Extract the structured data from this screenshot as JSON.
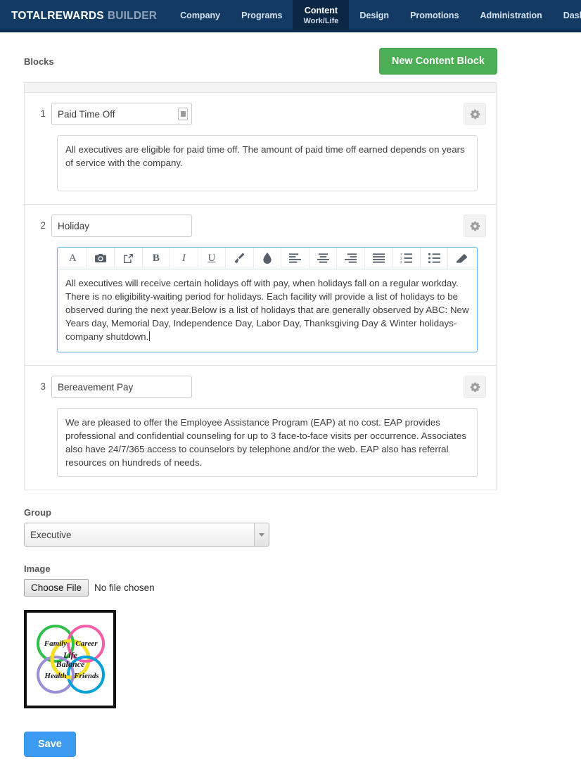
{
  "brand": {
    "strong": "TOTALREWARDS",
    "light": "BUILDER"
  },
  "nav": {
    "items": [
      {
        "label": "Company",
        "sub": "",
        "active": false,
        "name": "nav-item-company"
      },
      {
        "label": "Programs",
        "sub": "",
        "active": false,
        "name": "nav-item-programs"
      },
      {
        "label": "Content",
        "sub": "Work/Life",
        "active": true,
        "name": "nav-item-content"
      },
      {
        "label": "Design",
        "sub": "",
        "active": false,
        "name": "nav-item-design"
      },
      {
        "label": "Promotions",
        "sub": "",
        "active": false,
        "name": "nav-item-promotions"
      },
      {
        "label": "Administration",
        "sub": "",
        "active": false,
        "name": "nav-item-administration"
      },
      {
        "label": "Dashboard",
        "sub": "",
        "active": false,
        "name": "nav-item-dashboard"
      }
    ]
  },
  "toolbar": {
    "blocks_label": "Blocks",
    "new_block_label": "New Content Block",
    "new_block_color": "#4cae55"
  },
  "blocks": [
    {
      "number": "1",
      "title": "Paid Time Off",
      "body": "All executives are eligible for paid time off. The amount of paid time off earned depends on years of service with the company.",
      "has_grip": true,
      "editing": false
    },
    {
      "number": "2",
      "title": "Holiday",
      "body": "All executives will receive certain holidays off with pay, when holidays fall on a regular workday. There is no eligibility-waiting period for holidays. Each facility will provide a list of holidays to be observed during the next year.Below is a list of holidays that are generally observed by ABC: New Years day, Memorial Day, Independence Day, Labor Day, Thanksgiving Day & Winter holidays-company shutdown.",
      "has_grip": false,
      "editing": true
    },
    {
      "number": "3",
      "title": "Bereavement Pay",
      "body": "We are pleased to offer the Employee Assistance Program (EAP) at no cost. EAP provides professional and confidential counseling for up to 3 face-to-face visits per occurrence.  Associates also have 24/7/365 access to counselors by telephone and/or the web. EAP also has referral resources on hundreds of needs.",
      "has_grip": false,
      "editing": false
    }
  ],
  "editor_toolbar": {
    "icons": [
      "font-icon",
      "camera-icon",
      "external-link-icon",
      "bold-icon",
      "italic-icon",
      "underline-icon",
      "paintbrush-icon",
      "color-drop-icon",
      "align-left-icon",
      "align-center-icon",
      "align-right-icon",
      "align-justify-icon",
      "ordered-list-icon",
      "unordered-list-icon",
      "eraser-icon"
    ]
  },
  "group": {
    "label": "Group",
    "value": "Executive",
    "options": [
      "Executive"
    ]
  },
  "image": {
    "label": "Image",
    "choose_label": "Choose File",
    "no_file_label": "No file chosen",
    "thumbnail": {
      "center_line1": "Life",
      "center_line2": "Balance",
      "circles": [
        {
          "label": "Family",
          "color": "#2fbf4a"
        },
        {
          "label": "Career",
          "color": "#f25fa8"
        },
        {
          "label": "Health",
          "color": "#9a8ed8"
        },
        {
          "label": "Friends",
          "color": "#00a0d8"
        }
      ],
      "ring_color": "#f5e029"
    }
  },
  "save": {
    "label": "Save",
    "color": "#3d9bf1"
  }
}
